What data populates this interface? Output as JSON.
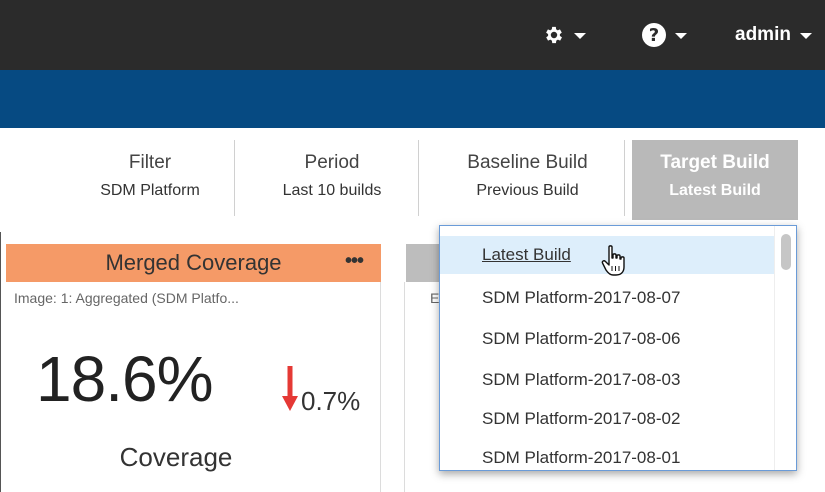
{
  "topbar": {
    "help_label": "?",
    "user_label": "admin",
    "background": "#2b2b2b",
    "icons": [
      "gear-icon",
      "help-icon",
      "caret-down-icon"
    ]
  },
  "blueband": {
    "color": "#064a82"
  },
  "filters": {
    "filter": {
      "title": "Filter",
      "value": "SDM Platform"
    },
    "period": {
      "title": "Period",
      "value": "Last 10 builds"
    },
    "baseline": {
      "title": "Baseline Build",
      "value": "Previous Build"
    },
    "target": {
      "title": "Target Build",
      "value": "Latest Build",
      "active": true
    }
  },
  "card": {
    "title": "Merged Coverage",
    "more": "•••",
    "subtitle": "Image: 1: Aggregated (SDM Platfo...",
    "value": "18.6%",
    "delta": "0.7%",
    "delta_direction": "down",
    "label": "Coverage",
    "header_color": "#f59a67",
    "delta_color": "#e53935"
  },
  "card2": {
    "subtitle": "E"
  },
  "dropdown": {
    "items": [
      {
        "label": "Latest Build",
        "selected": true
      },
      {
        "label": "SDM Platform-2017-08-07"
      },
      {
        "label": "SDM Platform-2017-08-06"
      },
      {
        "label": "SDM Platform-2017-08-03"
      },
      {
        "label": "SDM Platform-2017-08-02"
      },
      {
        "label": "SDM Platform-2017-08-01"
      }
    ]
  }
}
